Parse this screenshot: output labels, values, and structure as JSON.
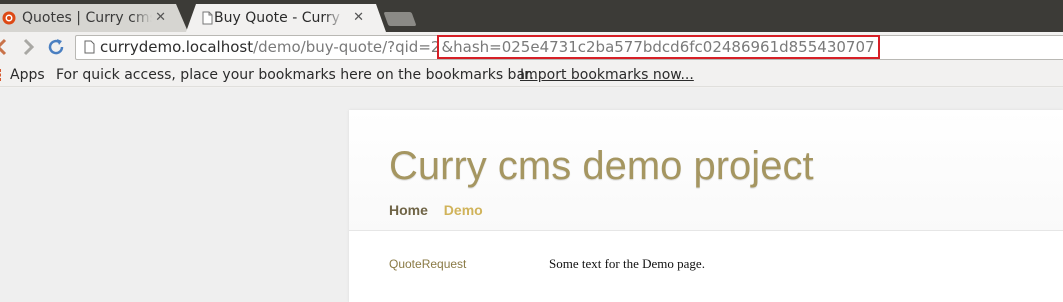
{
  "browser": {
    "tabs": [
      {
        "title": "Quotes | Curry cms d",
        "favicon": "ubuntu-logo-icon",
        "active": false
      },
      {
        "title": "Buy Quote - Curry cm",
        "favicon": "page-icon",
        "active": true
      }
    ],
    "close_glyph": "✕",
    "address": {
      "host": "currydemo.localhost",
      "path": "/demo/buy-quote/?qid=2",
      "highlighted": "&hash=025e4731c2ba577bdcd6fc02486961d855430707",
      "highlight_color": "#d61f26"
    },
    "bookmarks": {
      "apps_label": "Apps",
      "hint": "For quick access, place your bookmarks here on the bookmarks bar.",
      "import_link": "Import bookmarks now..."
    }
  },
  "site": {
    "title": "Curry cms demo project",
    "nav": [
      {
        "label": "Home"
      },
      {
        "label": "Demo"
      }
    ],
    "sidebar_link": "QuoteRequest",
    "content": "Some text for the Demo page.",
    "colors": {
      "title": "#a59661",
      "nav_home": "#6f6446",
      "nav_demo": "#d0b35a",
      "link": "#8a7a45"
    }
  }
}
